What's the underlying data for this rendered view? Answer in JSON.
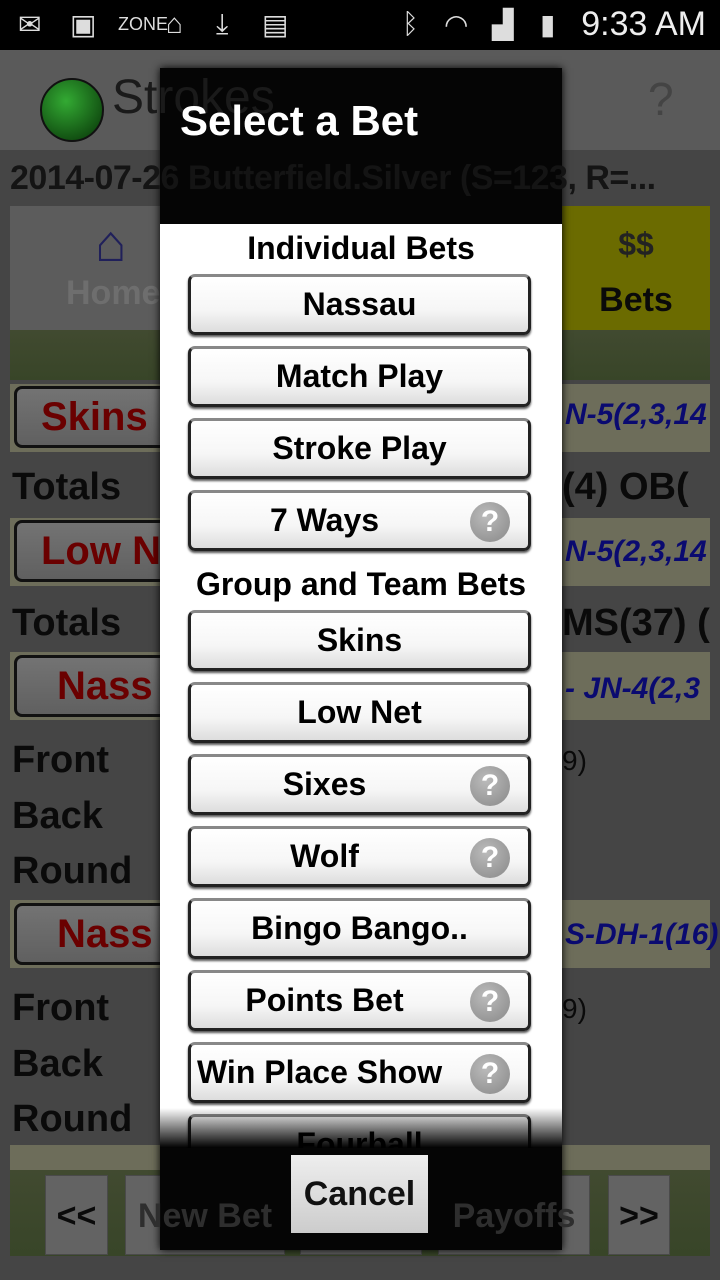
{
  "status_bar": {
    "time": "9:33 AM",
    "icons": [
      "mail-icon",
      "image-icon",
      "zone-icon",
      "voicemail-icon",
      "download-icon",
      "bag-icon",
      "bluetooth-icon",
      "wifi-icon",
      "signal-icon",
      "battery-icon"
    ]
  },
  "app": {
    "title": "Strokes",
    "subtitle": "2014-07-26 Butterfield.Silver (S=123, R=..."
  },
  "tabs": {
    "home": "Home",
    "bets": "Bets"
  },
  "background": {
    "rows": [
      {
        "button": "Skins",
        "detail": "N-5(2,3,14"
      },
      {
        "button": "Low N",
        "detail": "N-5(2,3,14"
      },
      {
        "button": "Nass",
        "detail": "- JN-4(2,3"
      },
      {
        "button": "Nass",
        "detail": "S-DH-1(16)"
      }
    ],
    "totals": [
      {
        "label": "Totals",
        "value": "(4) OB("
      },
      {
        "label": "Totals",
        "value": "MS(37) ("
      }
    ],
    "front": "Front",
    "back": "Back",
    "round": "Round",
    "front_value": "9)",
    "bottom": {
      "prev": "<<",
      "new_bet": "New Bet",
      "payoffs": "Payoffs",
      "next": ">>"
    }
  },
  "dialog": {
    "title": "Select a Bet",
    "individual_header": "Individual Bets",
    "individual": [
      {
        "label": "Nassau",
        "help": false
      },
      {
        "label": "Match Play",
        "help": false
      },
      {
        "label": "Stroke Play",
        "help": false
      },
      {
        "label": "7 Ways",
        "help": true
      }
    ],
    "group_header": "Group and Team Bets",
    "group": [
      {
        "label": "Skins",
        "help": false
      },
      {
        "label": "Low Net",
        "help": false
      },
      {
        "label": "Sixes",
        "help": true
      },
      {
        "label": "Wolf",
        "help": true
      },
      {
        "label": "Bingo Bango..",
        "help": false
      },
      {
        "label": "Points Bet",
        "help": true
      },
      {
        "label": "Win Place Show",
        "help": true
      },
      {
        "label": "Fourball",
        "help": false
      }
    ],
    "help_glyph": "?",
    "cancel": "Cancel"
  }
}
